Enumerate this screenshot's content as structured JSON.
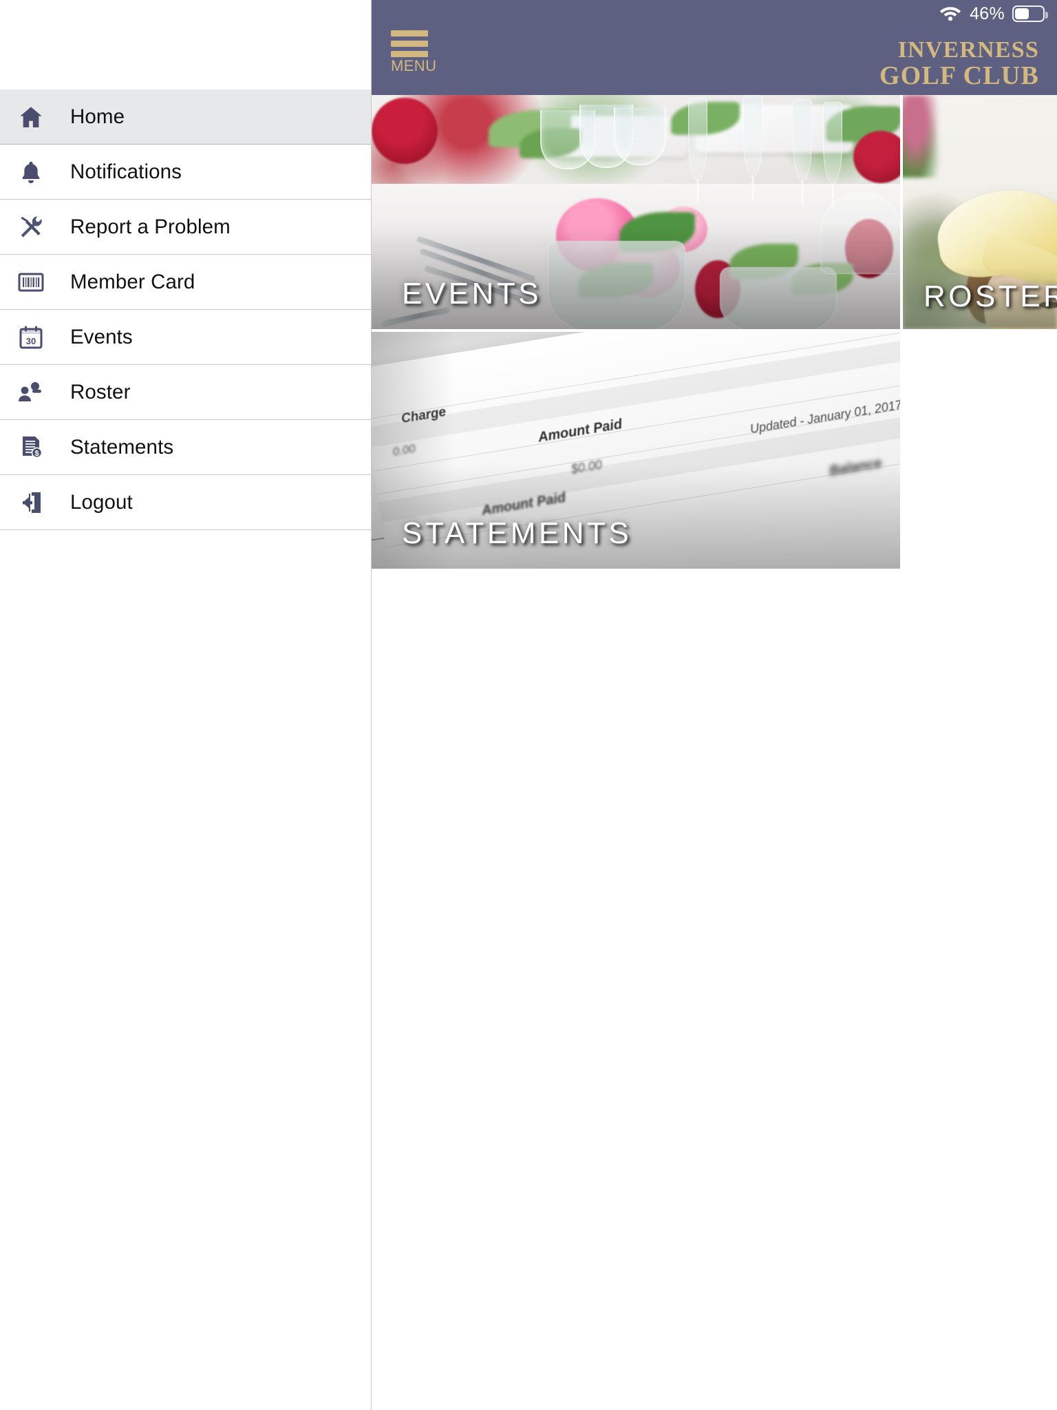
{
  "statusbar": {
    "wifi_icon": "wifi-icon",
    "battery_percent": "46%",
    "battery_icon": "battery-icon",
    "battery_level": 46,
    "background_color": "#5d6080",
    "text_color": "#ffffff"
  },
  "appbar": {
    "menu_icon": "hamburger-menu-icon",
    "menu_label": "MENU",
    "brand_line1": "INVERNESS",
    "brand_line2": "GOLF CLUB",
    "background_color": "#5d6080",
    "accent_color": "#d4b87f"
  },
  "drawer": {
    "open": true,
    "background_color": "#ffffff",
    "active_background_color": "#e7e8e9",
    "icon_color": "#4b4d6e",
    "items": [
      {
        "label": "Home",
        "icon": "home-icon",
        "active": true
      },
      {
        "label": "Notifications",
        "icon": "bell-icon",
        "active": false
      },
      {
        "label": "Report a Problem",
        "icon": "tools-icon",
        "active": false
      },
      {
        "label": "Member Card",
        "icon": "barcode-icon",
        "active": false
      },
      {
        "label": "Events",
        "icon": "calendar-icon",
        "active": false
      },
      {
        "label": "Roster",
        "icon": "people-icon",
        "active": false
      },
      {
        "label": "Statements",
        "icon": "invoice-icon",
        "active": false
      },
      {
        "label": "Logout",
        "icon": "logout-icon",
        "active": false
      }
    ]
  },
  "tiles": [
    {
      "label": "EVENTS",
      "photo": "banquet-table-with-roses-and-glassware"
    },
    {
      "label": "ROSTER",
      "photo": "woman-in-yellow-golf-cap-outdoors"
    },
    {
      "label": "STATEMENTS",
      "photo": "printed-account-statement-on-desk"
    }
  ],
  "statement_photo_text": {
    "charge_header": "Charge",
    "charge_value": "0.00",
    "amount_paid_header_1": "Amount Paid",
    "amount_paid_value_1": "$0.00",
    "amount_paid_header_2": "Amount Paid",
    "updated_line": "Updated - January 01, 2017",
    "balance_header": "Balance"
  },
  "calendar_icon_day": "30"
}
